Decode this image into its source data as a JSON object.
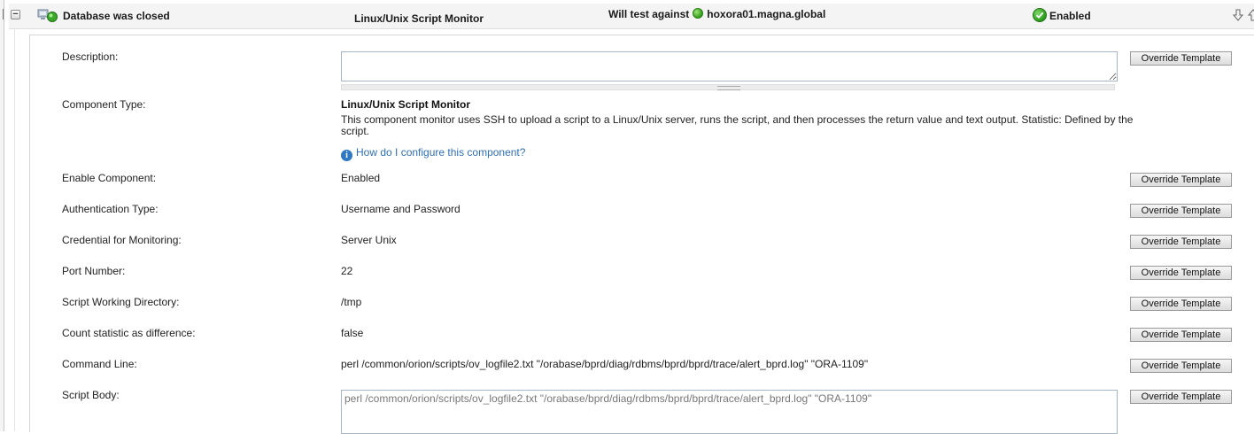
{
  "header": {
    "component_name": "Database was closed",
    "component_type": "Linux/Unix Script Monitor",
    "test_label": "Will test against",
    "test_target": "hoxora01.magna.global",
    "status": "Enabled",
    "collapse_symbol": "−",
    "icons": [
      "application-monitor-icon",
      "status-up-icon",
      "check-icon",
      "move-down-icon",
      "move-up-icon"
    ]
  },
  "fields": {
    "description": {
      "label": "Description:",
      "value": ""
    },
    "component_type": {
      "label": "Component Type:",
      "title": "Linux/Unix Script Monitor",
      "description": "This component monitor uses SSH to upload a script to a Linux/Unix server, runs the script, and then processes the return value and text output. Statistic: Defined by the script.",
      "help_link": "How do I configure this component?"
    },
    "enable_component": {
      "label": "Enable Component:",
      "value": "Enabled"
    },
    "authentication_type": {
      "label": "Authentication Type:",
      "value": "Username and Password"
    },
    "credential": {
      "label": "Credential for Monitoring:",
      "value": "Server Unix"
    },
    "port_number": {
      "label": "Port Number:",
      "value": "22"
    },
    "working_directory": {
      "label": "Script Working Directory:",
      "value": "/tmp"
    },
    "count_statistic": {
      "label": "Count statistic as difference:",
      "value": "false"
    },
    "command_line": {
      "label": "Command Line:",
      "value": "perl /common/orion/scripts/ov_logfile2.txt \"/orabase/bprd/diag/rdbms/bprd/bprd/trace/alert_bprd.log\" \"ORA-1109\""
    },
    "script_body": {
      "label": "Script Body:",
      "value": "perl /common/orion/scripts/ov_logfile2.txt \"/orabase/bprd/diag/rdbms/bprd/bprd/trace/alert_bprd.log\" \"ORA-1109\""
    }
  },
  "buttons": {
    "override": "Override Template"
  },
  "colors": {
    "link": "#2f6fb3",
    "status_green": "#2f9c17",
    "header_bg": "#f4f4f4"
  }
}
